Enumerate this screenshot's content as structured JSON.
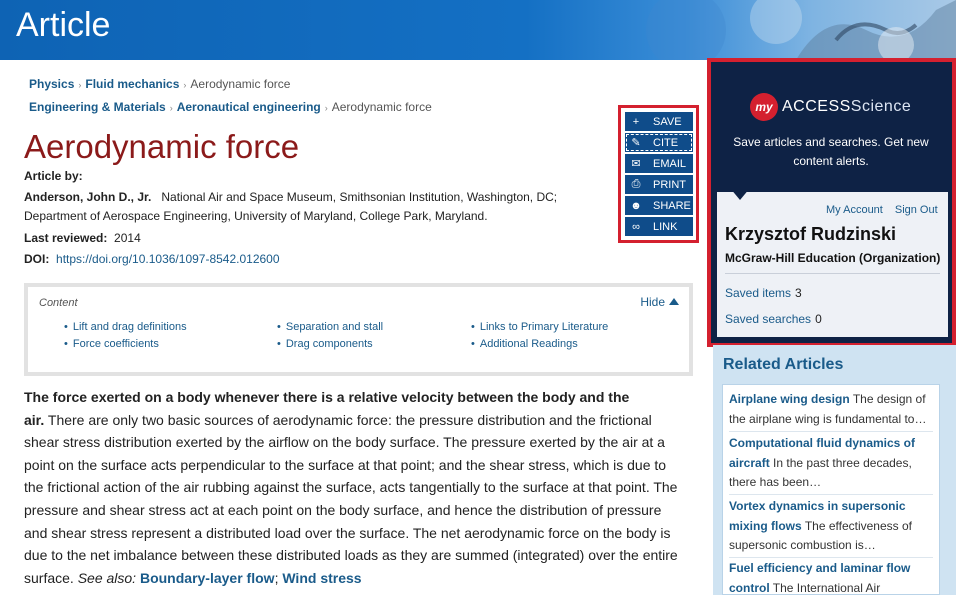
{
  "header": {
    "title": "Article"
  },
  "breadcrumbs": [
    {
      "items": [
        "Physics",
        "Fluid mechanics"
      ],
      "current": "Aerodynamic force"
    },
    {
      "items": [
        "Engineering & Materials",
        "Aeronautical engineering"
      ],
      "current": "Aerodynamic force"
    }
  ],
  "article": {
    "title": "Aerodynamic force",
    "article_by_label": "Article by:",
    "author_name": "Anderson, John D., Jr.",
    "author_affil_1": "National Air and Space Museum, Smithsonian Institution, Washington, DC;",
    "author_affil_2": "Department of Aerospace Engineering, University of Maryland, College Park, Maryland.",
    "last_reviewed_label": "Last reviewed:",
    "last_reviewed_value": "2014",
    "doi_label": "DOI:",
    "doi_value": "https://doi.org/10.1036/1097-8542.012600"
  },
  "toolbar": {
    "save": "SAVE",
    "cite": "CITE",
    "email": "EMAIL",
    "print": "PRINT",
    "share": "SHARE",
    "link": "LINK"
  },
  "contents": {
    "label": "Content",
    "hide_label": "Hide",
    "col1": [
      "Lift and drag definitions",
      "Force coefficients"
    ],
    "col2": [
      "Separation and stall",
      "Drag components"
    ],
    "col3": [
      "Links to Primary Literature",
      "Additional Readings"
    ]
  },
  "body": {
    "lead_bold_1": "The force exerted on a body whenever there is a relative velocity between the body and the",
    "lead_bold_2": "air.",
    "line_1_rest": "There are only two basic sources of aerodynamic force: the pressure distribution and the frictional",
    "line_2": "shear stress distribution exerted by the airflow on the body surface. The pressure exerted by the air at a",
    "line_3": "point on the surface acts perpendicular to the surface at that point; and the shear stress, which is due to",
    "line_4": "the frictional action of the air rubbing against the surface, acts tangentially to the surface at that point. The",
    "line_5": "pressure and shear stress act at each point on the body surface, and hence the distribution of pressure",
    "line_6": "and shear stress represent a distributed load over the surface. The net aerodynamic force on the body is",
    "line_7": "due to the net imbalance between these distributed loads as they are summed (integrated) over the entire",
    "line_8_start": "surface.",
    "see_also": "See also:",
    "link_1": "Boundary-layer flow",
    "link_sep": ";",
    "link_2": "Wind stress"
  },
  "account_panel": {
    "badge": "my",
    "brand_access": "ACCESS",
    "brand_science": "Science",
    "promo": "Save articles and searches. Get new content alerts.",
    "my_account": "My Account",
    "sign_out": "Sign Out",
    "user_name": "Krzysztof Rudzinski",
    "organization": "McGraw-Hill Education (Organization)",
    "saved_items_label": "Saved items",
    "saved_items_count": "3",
    "saved_searches_label": "Saved searches",
    "saved_searches_count": "0"
  },
  "related": {
    "title": "Related Articles",
    "items": [
      {
        "title": "Airplane wing design",
        "snippet": "The design of the airplane wing is fundamental to…"
      },
      {
        "title": "Computational fluid dynamics of aircraft",
        "snippet": "In the past three decades, there has been…"
      },
      {
        "title": "Vortex dynamics in supersonic mixing flows",
        "snippet": "The effectiveness of supersonic combustion is…"
      },
      {
        "title": "Fuel efficiency and laminar flow control",
        "snippet": "The International Air"
      }
    ]
  },
  "colors": {
    "header_blue": "#0e63b4",
    "title_red": "#8b1a1a",
    "link_blue": "#1a5b8a",
    "panel_navy": "#0e2245",
    "highlight_red": "#d4202f",
    "tool_blue": "#0f4c8a"
  },
  "icons": [
    "plus-icon",
    "pencil-icon",
    "envelope-icon",
    "printer-icon",
    "users-icon",
    "link-icon",
    "caret-up-icon"
  ]
}
